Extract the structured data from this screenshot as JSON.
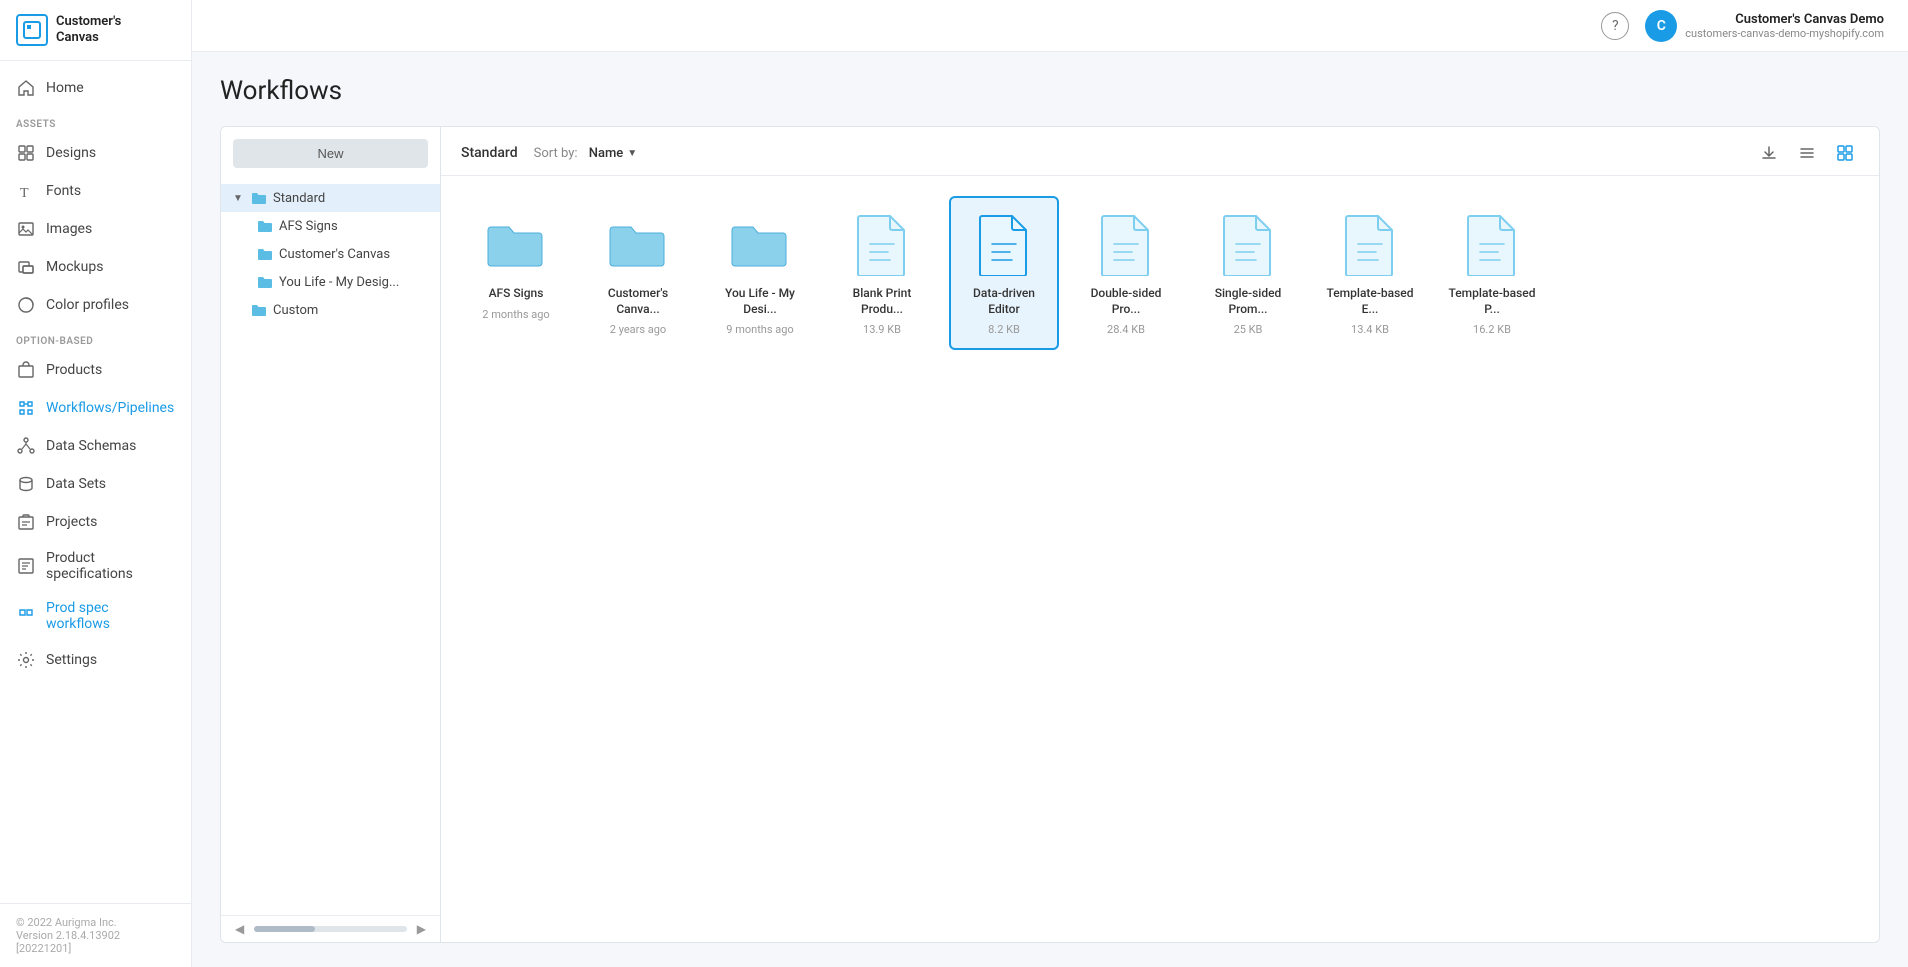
{
  "app": {
    "logo_text_line1": "Customer's",
    "logo_text_line2": "Canvas"
  },
  "topbar": {
    "help_label": "?",
    "user_name": "Customer's Canvas Demo",
    "user_sub": "customers-canvas-demo-myshopify.com",
    "avatar_initial": "C"
  },
  "sidebar": {
    "nav_items": [
      {
        "id": "home",
        "label": "Home",
        "icon": "home-icon"
      },
      {
        "id": "designs",
        "label": "Designs",
        "icon": "designs-icon"
      },
      {
        "id": "fonts",
        "label": "Fonts",
        "icon": "fonts-icon"
      },
      {
        "id": "images",
        "label": "Images",
        "icon": "images-icon"
      },
      {
        "id": "mockups",
        "label": "Mockups",
        "icon": "mockups-icon"
      },
      {
        "id": "color-profiles",
        "label": "Color profiles",
        "icon": "color-profiles-icon"
      }
    ],
    "section_option_based": "OPTION-BASED",
    "option_based_items": [
      {
        "id": "products",
        "label": "Products",
        "icon": "products-icon"
      },
      {
        "id": "workflows",
        "label": "Workflows/Pipelines",
        "icon": "workflows-icon",
        "active": true
      }
    ],
    "section_data": "",
    "data_items": [
      {
        "id": "data-schemas",
        "label": "Data Schemas",
        "icon": "data-schemas-icon"
      },
      {
        "id": "data-sets",
        "label": "Data Sets",
        "icon": "data-sets-icon"
      },
      {
        "id": "projects",
        "label": "Projects",
        "icon": "projects-icon"
      },
      {
        "id": "product-specifications",
        "label": "Product specifications",
        "icon": "product-spec-icon"
      },
      {
        "id": "prod-spec-workflows",
        "label": "Prod spec workflows",
        "icon": "prod-spec-workflows-icon",
        "active": true
      }
    ],
    "settings": {
      "label": "Settings",
      "icon": "settings-icon"
    },
    "footer_line1": "© 2022 Aurigma Inc.",
    "footer_line2": "Version 2.18.4.13902 [20221201]"
  },
  "page_title": "Workflows",
  "tree": {
    "new_button_label": "New",
    "items": [
      {
        "id": "standard",
        "label": "Standard",
        "level": "root",
        "expanded": true,
        "selected": true
      },
      {
        "id": "afs-signs",
        "label": "AFS Signs",
        "level": "child"
      },
      {
        "id": "customers-canvas",
        "label": "Customer's Canvas",
        "level": "child"
      },
      {
        "id": "you-life",
        "label": "You Life - My Desig...",
        "level": "child"
      },
      {
        "id": "custom",
        "label": "Custom",
        "level": "root"
      }
    ]
  },
  "files": {
    "breadcrumb": "Standard",
    "sort_label": "Sort by:",
    "sort_value": "Name",
    "items": [
      {
        "id": "afs-signs-folder",
        "type": "folder",
        "name": "AFS Signs",
        "meta": "2 months ago",
        "selected": false
      },
      {
        "id": "customers-canvas-folder",
        "type": "folder",
        "name": "Customer's Canva...",
        "meta": "2 years ago",
        "selected": false
      },
      {
        "id": "you-life-folder",
        "type": "folder",
        "name": "You Life - My Desi...",
        "meta": "9 months ago",
        "selected": false
      },
      {
        "id": "blank-print",
        "type": "file",
        "name": "Blank Print Produ...",
        "meta": "13.9 KB",
        "selected": false
      },
      {
        "id": "data-driven-editor",
        "type": "file",
        "name": "Data-driven Editor",
        "meta": "8.2 KB",
        "selected": true
      },
      {
        "id": "double-sided",
        "type": "file",
        "name": "Double-sided Pro...",
        "meta": "28.4 KB",
        "selected": false
      },
      {
        "id": "single-sided",
        "type": "file",
        "name": "Single-sided Prom...",
        "meta": "25 KB",
        "selected": false
      },
      {
        "id": "template-based-e",
        "type": "file",
        "name": "Template-based E...",
        "meta": "13.4 KB",
        "selected": false
      },
      {
        "id": "template-based-p",
        "type": "file",
        "name": "Template-based P...",
        "meta": "16.2 KB",
        "selected": false
      }
    ]
  }
}
